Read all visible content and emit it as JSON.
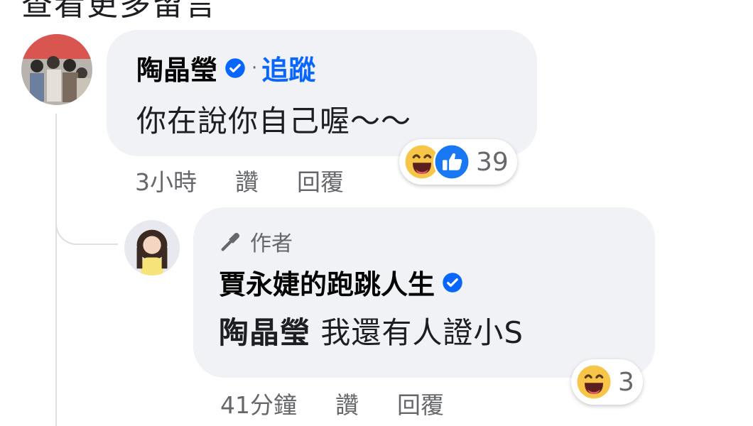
{
  "top_partial_text": "查看更多留言",
  "comment1": {
    "name": "陶晶瑩",
    "dot": "·",
    "follow": "追蹤",
    "text": "你在說你自己喔～～",
    "time": "3小時",
    "like": "讚",
    "reply": "回覆",
    "reaction_count": "39",
    "reactions": [
      "haha-icon",
      "like-icon"
    ]
  },
  "comment2": {
    "author_badge": "作者",
    "name": "賈永婕的跑跳人生",
    "mention": "陶晶瑩",
    "text": "我還有人證小S",
    "time": "41分鐘",
    "like": "讚",
    "reply": "回覆",
    "reaction_count": "3",
    "reactions": [
      "haha-icon"
    ]
  },
  "colors": {
    "bubble": "#f0f2f5",
    "link_blue": "#0866ff",
    "verified_blue": "#0866ff",
    "meta_gray": "#65676b",
    "haha_yellow": "#f7c548"
  }
}
